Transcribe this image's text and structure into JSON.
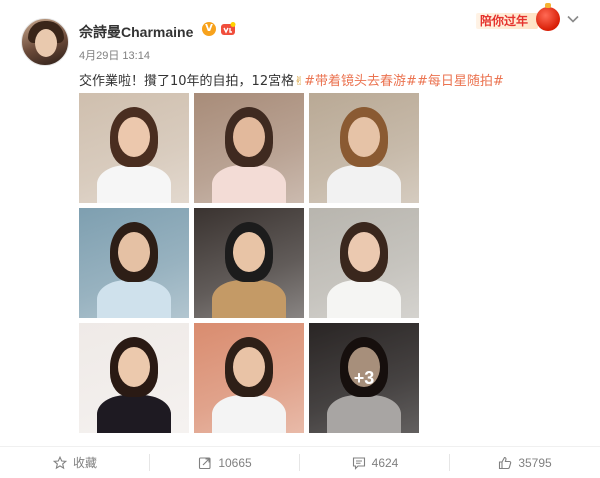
{
  "post": {
    "author": "佘詩曼Charmaine",
    "verified_icon": "v-badge-icon",
    "level_icon": "vip-level-icon",
    "timestamp": "4月29日 13:14",
    "text_main": "交作業啦！攢了10年的自拍，12宮格",
    "text_emoji": "✌",
    "hashtags": [
      "#带着镜头去春游#",
      "#每日星随拍#"
    ],
    "more_count": "+3",
    "photos": [
      {
        "name": "photo-1",
        "bg": "#cfbfae",
        "head": "#ecc8ad",
        "hair": "#4a2e20",
        "body": "#f6f6f6"
      },
      {
        "name": "photo-2",
        "bg": "#a88c79",
        "head": "#e2b99c",
        "hair": "#3f2a20",
        "body": "#f3dcd6"
      },
      {
        "name": "photo-3",
        "bg": "#b9a995",
        "head": "#e6c3a7",
        "hair": "#8a5a32",
        "body": "#f2f2f2"
      },
      {
        "name": "photo-4",
        "bg": "#7e9fb0",
        "head": "#e5c1a4",
        "hair": "#2d1e16",
        "body": "#cfe1ec"
      },
      {
        "name": "photo-5",
        "bg": "#3a3330",
        "head": "#e8c4a6",
        "hair": "#1c1c1c",
        "body": "#c49a66"
      },
      {
        "name": "photo-6",
        "bg": "#b8b5ae",
        "head": "#ebc9b0",
        "hair": "#3a271d",
        "body": "#f5f5f3"
      },
      {
        "name": "photo-7",
        "bg": "#efeae7",
        "head": "#ecc9ad",
        "hair": "#2a1a14",
        "body": "#1e1a22"
      },
      {
        "name": "photo-8",
        "bg": "#d98c6f",
        "head": "#e9c3a6",
        "hair": "#2e1f17",
        "body": "#f4f4f4"
      },
      {
        "name": "photo-9",
        "bg": "#3a3433",
        "head": "#e8c6ab",
        "hair": "#1f1612",
        "body": "#e9e5e2"
      }
    ]
  },
  "banner": {
    "label": "陪你过年",
    "icon": "lantern-icon"
  },
  "menu": {
    "icon": "chevron-down-icon"
  },
  "actions": {
    "favorite": {
      "label": "收藏",
      "icon": "star-icon"
    },
    "repost": {
      "count": "10665",
      "icon": "repost-icon"
    },
    "comment": {
      "count": "4624",
      "icon": "comment-icon"
    },
    "like": {
      "count": "35795",
      "icon": "thumb-up-icon"
    }
  },
  "colors": {
    "accent": "#eb7350",
    "muted": "#808080",
    "text": "#333333"
  }
}
